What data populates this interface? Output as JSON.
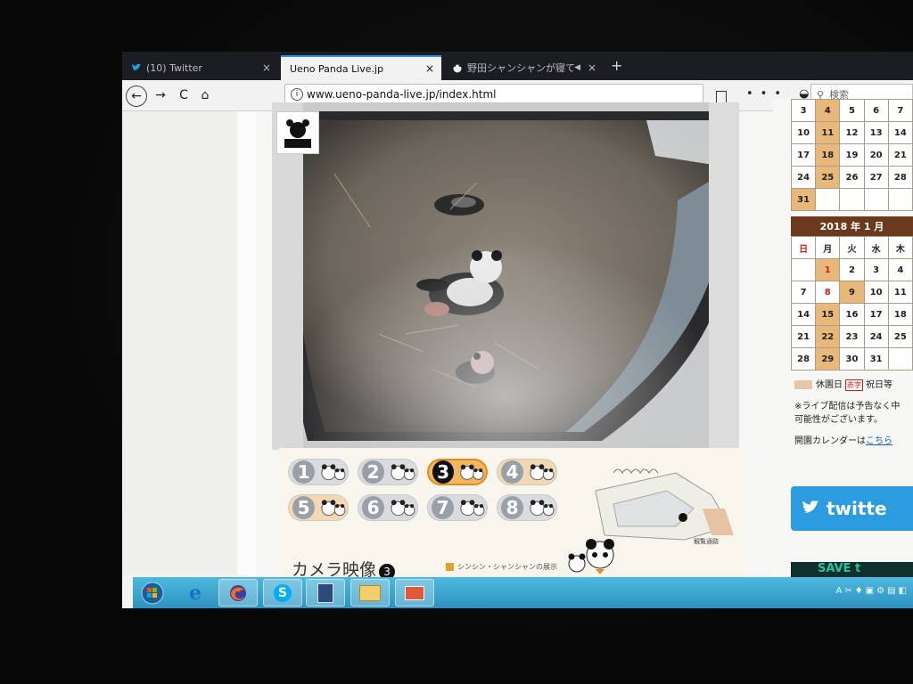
{
  "browser": {
    "tabs": [
      {
        "label": "(10) Twitter",
        "close": "×",
        "active": false
      },
      {
        "label": "Ueno Panda Live.jp",
        "close": "×",
        "active": true
      },
      {
        "label": "野田シャンシャンが寝て",
        "close": "×",
        "active": false
      }
    ],
    "newtab": "+",
    "url": "www.ueno-panda-live.jp/index.html",
    "search_placeholder": "検索",
    "nav": {
      "back": "←",
      "forward": "→",
      "reload": "C",
      "home": "⌂",
      "more": "•••"
    }
  },
  "camera_buttons": [
    {
      "num": "1",
      "active": false
    },
    {
      "num": "2",
      "active": false
    },
    {
      "num": "3",
      "active": true
    },
    {
      "num": "4",
      "active": false
    },
    {
      "num": "5",
      "active": false
    },
    {
      "num": "6",
      "active": false
    },
    {
      "num": "7",
      "active": false
    },
    {
      "num": "8",
      "active": false
    }
  ],
  "camera_title": "カメラ映像",
  "camera_title_num": "3",
  "legend_text": "シンシン・シャンシャンの展示",
  "map_label": "観覧通路",
  "calendar_dec": {
    "rows": [
      [
        "3",
        "4",
        "5",
        "6",
        "7"
      ],
      [
        "10",
        "11",
        "12",
        "13",
        "14"
      ],
      [
        "17",
        "18",
        "19",
        "20",
        "21"
      ],
      [
        "24",
        "25",
        "26",
        "27",
        "28"
      ],
      [
        "31",
        "",
        "",
        "",
        ""
      ]
    ],
    "closed": [
      "4",
      "11",
      "18",
      "25",
      "31"
    ]
  },
  "calendar_jan": {
    "header": "2018 年 1 月",
    "weekdays": [
      "日",
      "月",
      "火",
      "水",
      "木"
    ],
    "rows": [
      [
        "",
        "1",
        "2",
        "3",
        "4"
      ],
      [
        "7",
        "8",
        "9",
        "10",
        "11"
      ],
      [
        "14",
        "15",
        "16",
        "17",
        "18"
      ],
      [
        "21",
        "22",
        "23",
        "24",
        "25"
      ],
      [
        "28",
        "29",
        "30",
        "31",
        ""
      ]
    ],
    "closed": [
      "1",
      "9",
      "15",
      "22",
      "29"
    ],
    "red": [
      "1",
      "8"
    ]
  },
  "legend": {
    "closed_label": "休園日",
    "red_label": "赤字",
    "holiday_label": "祝日等"
  },
  "notice_line1": "※ライブ配信は予告なく中",
  "notice_line2": "可能性がございます。",
  "calendar_link_prefix": "開園カレンダーは",
  "calendar_link": "こちら",
  "twitter_label": "twitte",
  "save_label": "SAVE t",
  "colors": {
    "accent": "#2d8cf0",
    "closed": "#e8b87a",
    "calendar_header": "#6b3a1c",
    "twitter": "#2b9ce0",
    "taskbar": "#3aa6cf"
  }
}
